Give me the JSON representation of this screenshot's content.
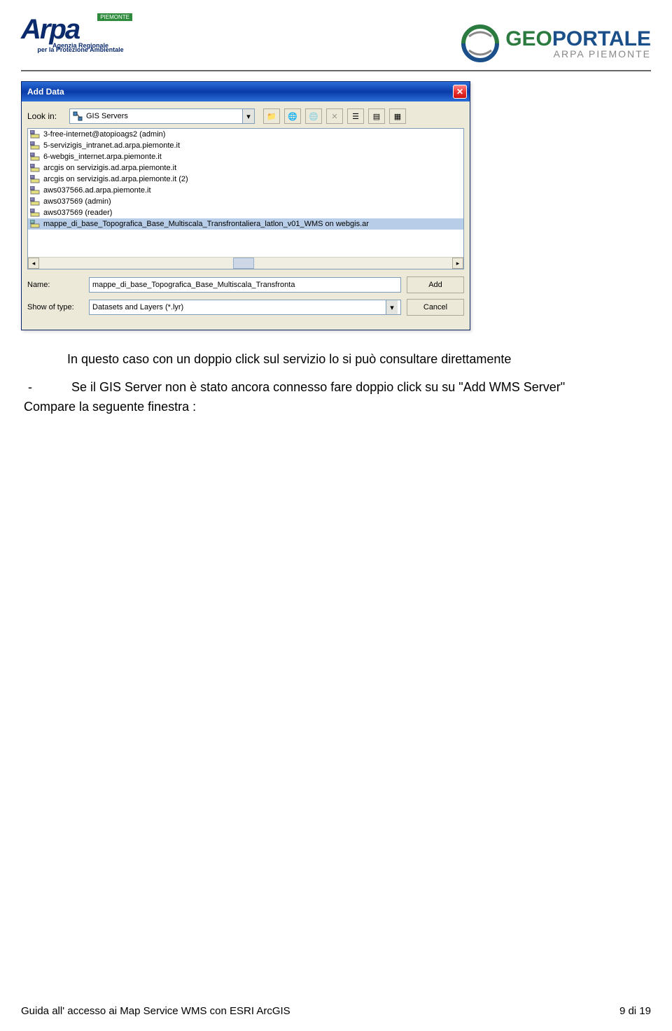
{
  "header": {
    "arpa_badge": "PIEMONTE",
    "arpa_sub1": "Agenzia Regionale",
    "arpa_sub2": "per la Protezione Ambientale",
    "geoportale_geo": "GEO",
    "geoportale_portale": "PORTALE",
    "geoportale_sub": "ARPA PIEMONTE"
  },
  "dialog": {
    "title": "Add Data",
    "look_in_label": "Look in:",
    "look_in_value": "GIS Servers",
    "items": [
      "3-free-internet@atopioags2 (admin)",
      "5-servizigis_intranet.ad.arpa.piemonte.it",
      "6-webgis_internet.arpa.piemonte.it",
      "arcgis on servizigis.ad.arpa.piemonte.it",
      "arcgis on servizigis.ad.arpa.piemonte.it (2)",
      "aws037566.ad.arpa.piemonte.it",
      "aws037569 (admin)",
      "aws037569 (reader)",
      "mappe_di_base_Topografica_Base_Multiscala_Transfrontaliera_latlon_v01_WMS on webgis.ar"
    ],
    "name_label": "Name:",
    "name_value": "mappe_di_base_Topografica_Base_Multiscala_Transfronta",
    "type_label": "Show of type:",
    "type_value": "Datasets and Layers (*.lyr)",
    "add_button": "Add",
    "cancel_button": "Cancel"
  },
  "body": {
    "p1": "In questo caso con un doppio click sul servizio lo si può consultare direttamente",
    "dash": "-",
    "p2": "Se il GIS Server non è stato ancora connesso fare doppio click su su \"Add WMS Server\"",
    "p3": "Compare la seguente finestra :"
  },
  "footer": {
    "left": "Guida all' accesso ai Map Service WMS con ESRI ArcGIS",
    "right": "9 di 19"
  }
}
